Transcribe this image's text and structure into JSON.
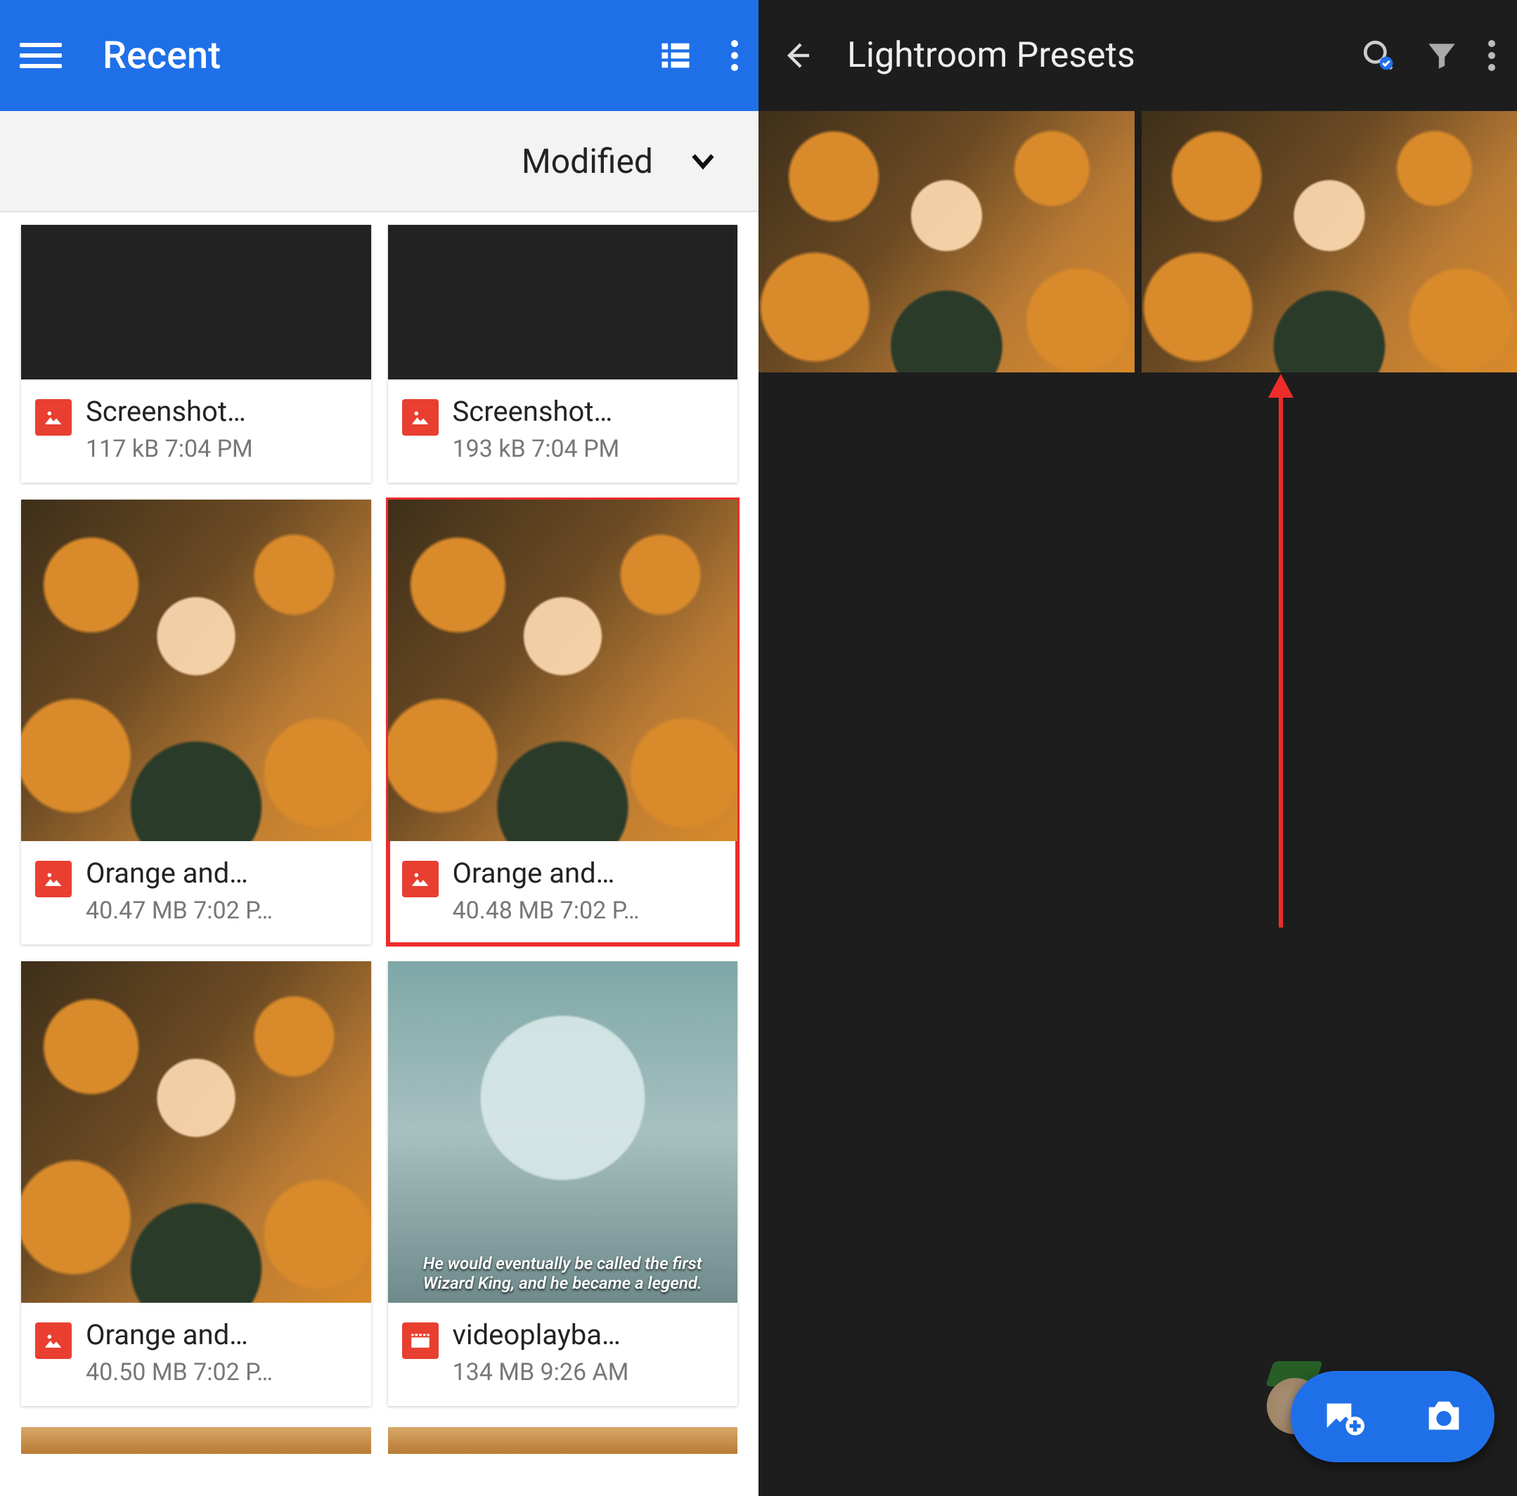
{
  "left": {
    "header": {
      "title": "Recent"
    },
    "sort": {
      "label": "Modified"
    },
    "files": [
      {
        "name": "Screenshot…",
        "size": "117 kB",
        "time": "7:04 PM",
        "kind": "img",
        "thumb": "dark",
        "short": true
      },
      {
        "name": "Screenshot…",
        "size": "193 kB",
        "time": "7:04 PM",
        "kind": "img",
        "thumb": "dark",
        "short": true
      },
      {
        "name": "Orange and…",
        "size": "40.47 MB",
        "time": "7:02 P…",
        "kind": "img",
        "thumb": "flowers"
      },
      {
        "name": "Orange and…",
        "size": "40.48 MB",
        "time": "7:02 P…",
        "kind": "img",
        "thumb": "flowers",
        "highlight": true
      },
      {
        "name": "Orange and…",
        "size": "40.50 MB",
        "time": "7:02 P…",
        "kind": "img",
        "thumb": "flowers"
      },
      {
        "name": "videoplayba…",
        "size": "134 MB",
        "time": "9:26 AM",
        "kind": "vid",
        "thumb": "video"
      }
    ]
  },
  "right": {
    "header": {
      "title": "Lightroom Presets"
    },
    "thumbs": [
      "flowers",
      "flowers"
    ]
  }
}
